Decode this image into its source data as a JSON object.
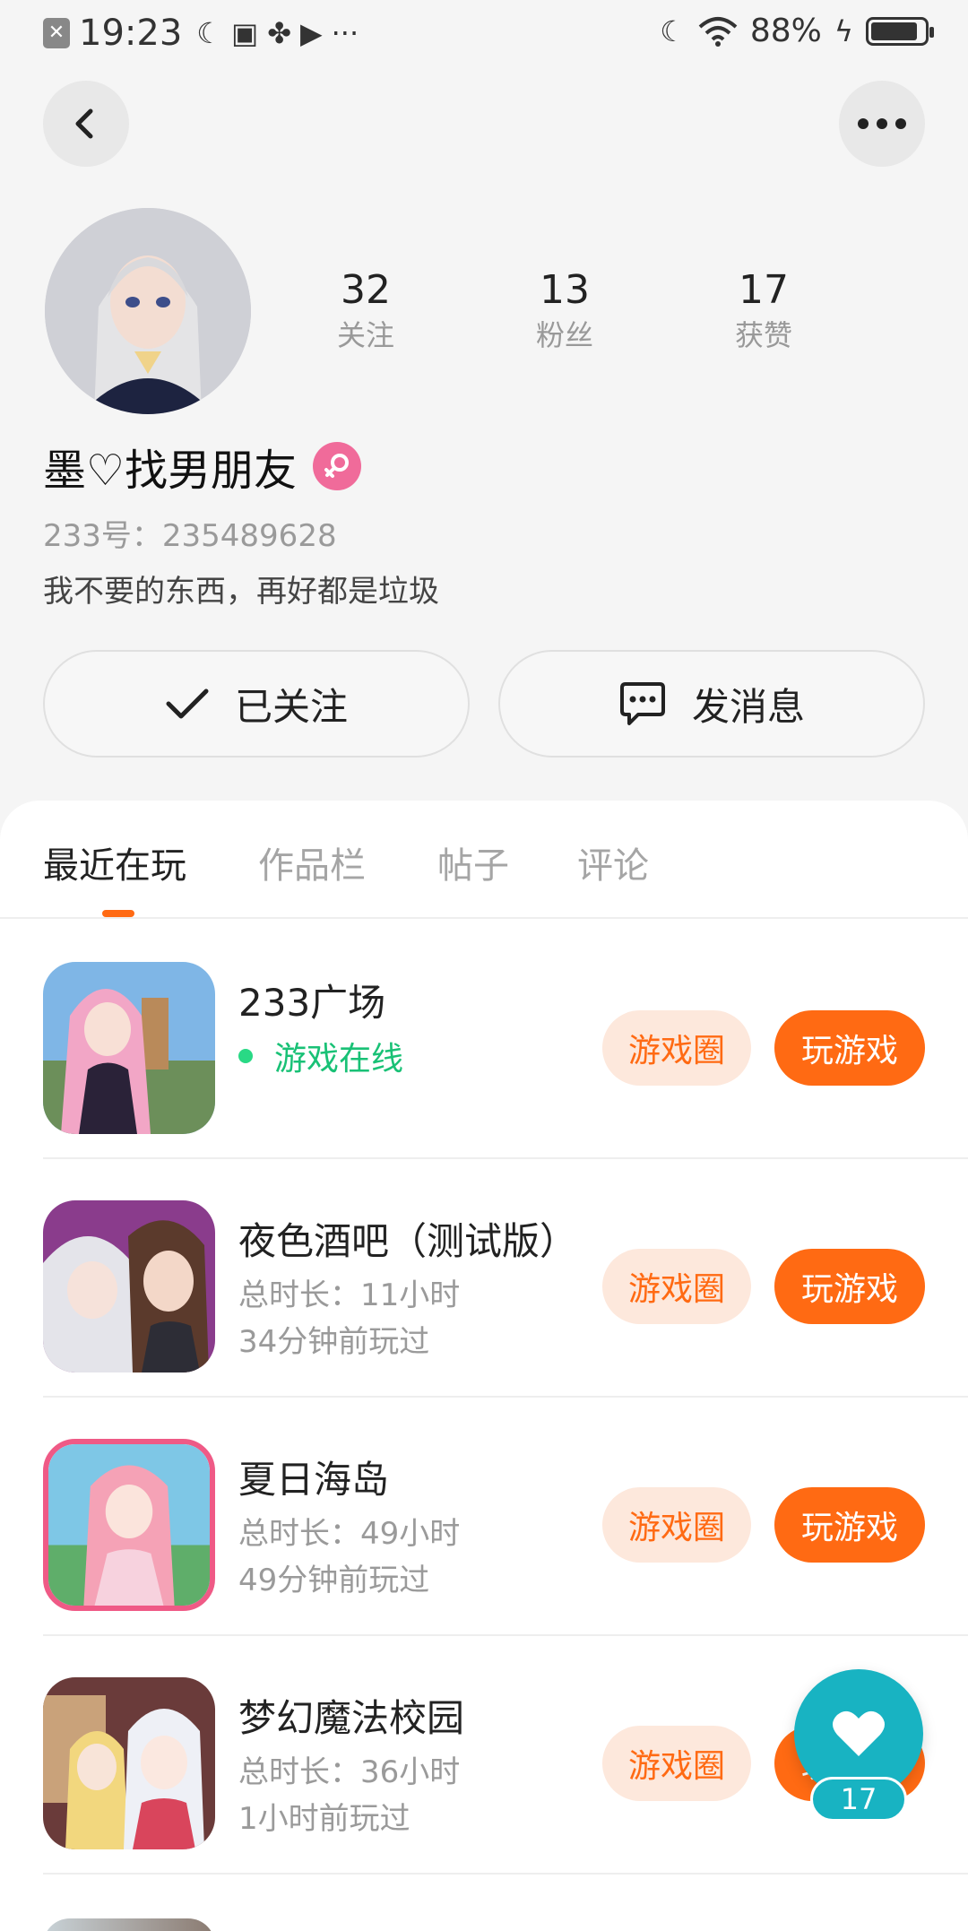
{
  "status_bar": {
    "time": "19:23",
    "dots": "···",
    "battery": "88%",
    "battery_level": 0.88
  },
  "profile": {
    "following_count": "32",
    "following_label": "关注",
    "followers_count": "13",
    "followers_label": "粉丝",
    "likes_count": "17",
    "likes_label": "获赞",
    "nickname": "墨♡找男朋友",
    "uid": "233号：235489628",
    "bio": "我不要的东西，再好都是垃圾",
    "followed_label": "已关注",
    "message_label": "发消息"
  },
  "tabs": [
    {
      "label": "最近在玩",
      "active": true
    },
    {
      "label": "作品栏",
      "active": false
    },
    {
      "label": "帖子",
      "active": false
    },
    {
      "label": "评论",
      "active": false
    }
  ],
  "games": [
    {
      "name": "233广场",
      "status": "游戏在线",
      "circle_label": "游戏圈",
      "play_label": "玩游戏"
    },
    {
      "name": "夜色酒吧（测试版）",
      "duration": "总时长：11小时",
      "last_played": "34分钟前玩过",
      "circle_label": "游戏圈",
      "play_label": "玩游戏"
    },
    {
      "name": "夏日海岛",
      "duration": "总时长：49小时",
      "last_played": "49分钟前玩过",
      "circle_label": "游戏圈",
      "play_label": "玩游戏"
    },
    {
      "name": "梦幻魔法校园",
      "duration": "总时长：36小时",
      "last_played": "1小时前玩过",
      "circle_label": "游戏圈",
      "play_label": "玩游戏"
    }
  ],
  "like_fab": {
    "count": "17"
  },
  "colors": {
    "accent": "#ff6a13",
    "accent_light": "#fde8dc",
    "online": "#19c176",
    "fab": "#18b3c2",
    "gender": "#f06b9a"
  },
  "icons": [
    "back-arrow-icon",
    "more-dots-icon",
    "check-icon",
    "chat-bubble-icon",
    "female-gender-icon",
    "heart-icon",
    "moon-icon",
    "wifi-icon",
    "battery-icon",
    "charging-icon"
  ]
}
